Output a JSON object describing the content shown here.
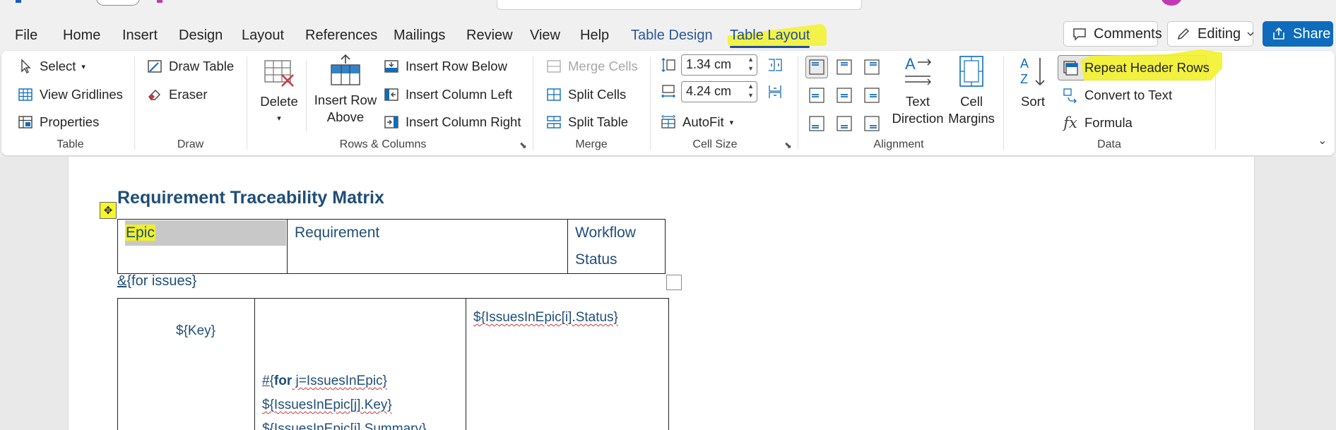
{
  "tabs": [
    {
      "label": "File"
    },
    {
      "label": "Home"
    },
    {
      "label": "Insert"
    },
    {
      "label": "Design"
    },
    {
      "label": "Layout"
    },
    {
      "label": "References"
    },
    {
      "label": "Mailings"
    },
    {
      "label": "Review"
    },
    {
      "label": "View"
    },
    {
      "label": "Help"
    },
    {
      "label": "Table Design"
    },
    {
      "label": "Table Layout"
    }
  ],
  "header_actions": {
    "comments": "Comments",
    "editing": "Editing",
    "share": "Share"
  },
  "ribbon": {
    "table": {
      "label": "Table",
      "select": "Select",
      "view_gridlines": "View Gridlines",
      "properties": "Properties"
    },
    "draw": {
      "label": "Draw",
      "draw_table": "Draw Table",
      "eraser": "Eraser"
    },
    "rows_columns": {
      "label": "Rows & Columns",
      "delete": "Delete",
      "insert_row_above_1": "Insert Row",
      "insert_row_above_2": "Above",
      "insert_row_below": "Insert Row Below",
      "insert_column_left": "Insert Column Left",
      "insert_column_right": "Insert Column Right"
    },
    "merge": {
      "label": "Merge",
      "merge_cells": "Merge Cells",
      "split_cells": "Split Cells",
      "split_table": "Split Table"
    },
    "cell_size": {
      "label": "Cell Size",
      "height": "1.34 cm",
      "width": "4.24 cm",
      "autofit": "AutoFit"
    },
    "alignment": {
      "label": "Alignment",
      "text_direction_1": "Text",
      "text_direction_2": "Direction",
      "cell_margins_1": "Cell",
      "cell_margins_2": "Margins"
    },
    "data": {
      "label": "Data",
      "sort": "Sort",
      "repeat_header_rows": "Repeat Header Rows",
      "convert_to_text": "Convert to Text",
      "formula": "Formula"
    }
  },
  "document": {
    "title": "Requirement Traceability Matrix",
    "header_row": {
      "col1": "Epic",
      "col2": "Requirement",
      "col3_line1": "Workflow",
      "col3_line2": "Status"
    },
    "for_prefix": "&",
    "for_rest": "{for issues}",
    "body": {
      "key": "${Key}",
      "status": "${IssuesInEpic[i].Status}",
      "loop_prefix": "#{",
      "loop_for": "for",
      "loop_rest": " j=IssuesInEpic}",
      "line_key": "${IssuesInEpic[j].Key}",
      "line_summary": "${IssuesInEpic[j].Summary}"
    }
  },
  "colors": {
    "accent": "#1e4f9a",
    "highlight": "#f2f22b",
    "doc_text": "#1f4e79",
    "share_bg": "#0f6cbd"
  }
}
